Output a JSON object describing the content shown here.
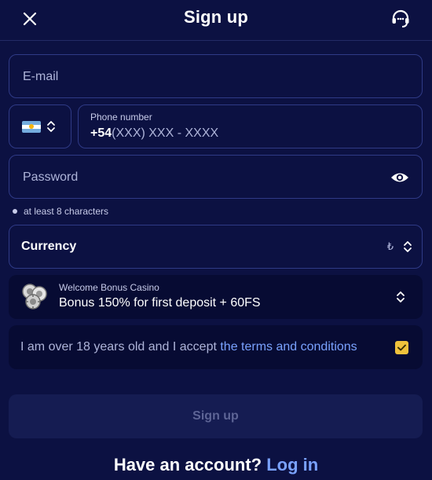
{
  "header": {
    "title": "Sign up",
    "close_icon": "close-icon",
    "support_icon": "headset-support-icon"
  },
  "form": {
    "email": {
      "placeholder": "E-mail",
      "value": ""
    },
    "country": {
      "flag": "argentina-flag-icon",
      "colors": {
        "light_blue": "#74acdf",
        "white": "#ffffff",
        "sun": "#f6b40e"
      }
    },
    "phone": {
      "label": "Phone number",
      "code": "+54",
      "mask": "(XXX) XXX - XXXX"
    },
    "password": {
      "placeholder": "Password",
      "value": "",
      "hint": "at least 8 characters",
      "toggle_icon": "eye-icon"
    },
    "currency": {
      "label": "Currency",
      "symbol": "₺"
    },
    "bonus": {
      "label": "Welcome Bonus Casino",
      "value": "Bonus 150% for first deposit + 60FS",
      "icon": "casino-chips-icon"
    },
    "terms": {
      "text": "I am over 18 years old and I accept ",
      "link": "the terms and conditions",
      "checked": true
    },
    "submit_label": "Sign up"
  },
  "footer": {
    "question": "Have an account? ",
    "login_link": "Log in"
  },
  "colors": {
    "background": "#0c1142",
    "border": "#2f3a86",
    "card": "#070b33",
    "link": "#7aa2ff",
    "checkbox": "#f0c23c",
    "disabled_button": "#151c52"
  }
}
